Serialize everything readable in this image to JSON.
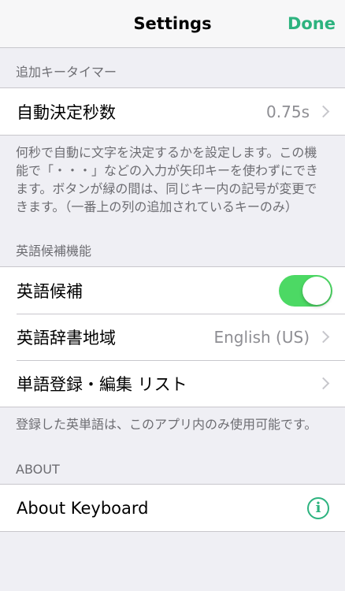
{
  "navbar": {
    "title": "Settings",
    "done_label": "Done"
  },
  "section_additional_keys": {
    "header": "追加キータイマー",
    "rows": [
      {
        "label": "自動決定秒数",
        "value": "0.75s"
      }
    ],
    "footer": "何秒で自動に文字を決定するかを設定します。この機能で「・・・」などの入力が矢印キーを使わずにできます。ボタンが緑の間は、同じキー内の記号が変更できます。（一番上の列の追加されているキーのみ）"
  },
  "section_english": {
    "header": "英語候補機能",
    "rows": [
      {
        "label": "英語候補",
        "toggle_on": true
      },
      {
        "label": "英語辞書地域",
        "value": "English (US)"
      },
      {
        "label": "単語登録・編集 リスト"
      }
    ],
    "footer": "登録した英単語は、このアプリ内のみ使用可能です。"
  },
  "section_about": {
    "header": "ABOUT",
    "rows": [
      {
        "label": "About Keyboard",
        "icon": "info-icon"
      }
    ]
  },
  "colors": {
    "accent": "#2db37f",
    "toggle_on": "#4cd964",
    "background": "#efeff4"
  }
}
